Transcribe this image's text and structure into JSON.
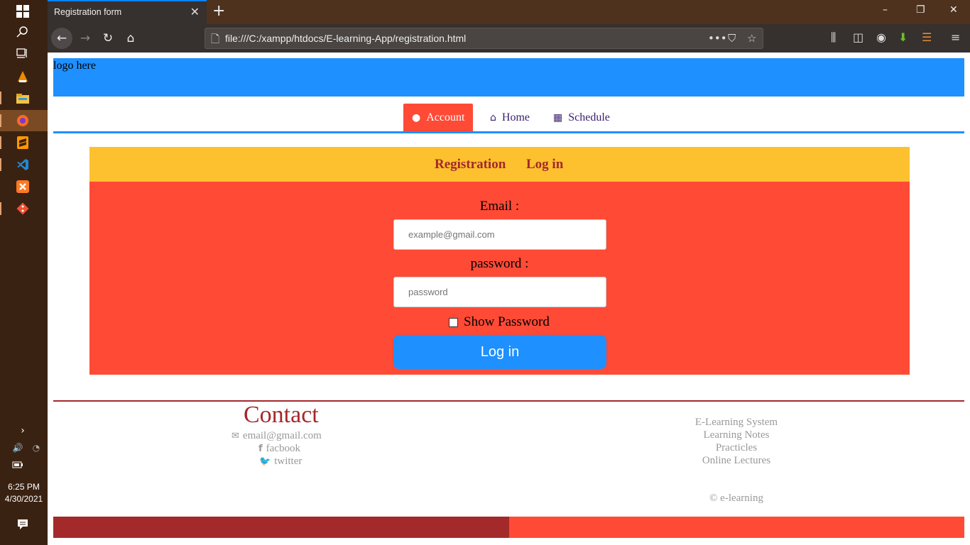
{
  "taskbar": {
    "time": "6:25 PM",
    "date": "4/30/2021"
  },
  "browser": {
    "tab_title": "Registration form",
    "url": "file:///C:/xampp/htdocs/E-learning-App/registration.html"
  },
  "page": {
    "logo_text": "logo here",
    "menu": [
      {
        "label": "Account",
        "icon": "user-icon"
      },
      {
        "label": "Home",
        "icon": "home-icon"
      },
      {
        "label": "Schedule",
        "icon": "calendar-icon"
      }
    ],
    "form_tabs": {
      "registration": "Registration",
      "login": "Log in"
    },
    "form": {
      "email_label": "Email :",
      "email_placeholder": "example@gmail.com",
      "password_label": "password :",
      "password_placeholder": "password",
      "show_password_label": "Show Password",
      "submit_label": "Log in"
    },
    "footer": {
      "contact_title": "Contact",
      "email": "email@gmail.com",
      "facebook": "facbook",
      "twitter": "twitter",
      "links": [
        "E-Learning System",
        "Learning Notes",
        "Practicles",
        "Online Lectures"
      ],
      "copyright": "© e-learning"
    }
  },
  "colors": {
    "primary_blue": "#1e90ff",
    "accent_red": "#ff4a36",
    "dark_red": "#a3292a",
    "yellow": "#fdc02f"
  }
}
